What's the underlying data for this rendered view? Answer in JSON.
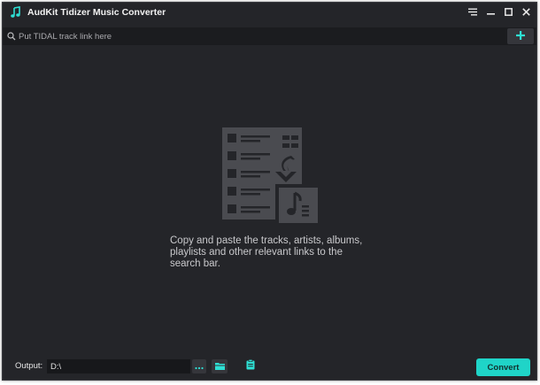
{
  "titlebar": {
    "title": "AudKit Tidizer Music Converter",
    "icons": [
      "music-note-logo",
      "menu-icon",
      "minimize-icon",
      "maximize-icon",
      "close-icon"
    ]
  },
  "search": {
    "placeholder": "Put TIDAL track link here",
    "value": "",
    "add_icon": "plus-icon"
  },
  "main": {
    "hint": "Copy and paste the tracks, artists, albums, playlists and other relevant links to the search bar.",
    "illustration_icon": "playlist-music-icon"
  },
  "footer": {
    "output_label": "Output:",
    "output_path": "D:\\",
    "more_icon": "ellipsis-icon",
    "folder_icon": "folder-icon",
    "history_icon": "history-list-icon",
    "convert_label": "Convert"
  },
  "colors": {
    "accent": "#1fd4c8",
    "background": "#242529",
    "searchbar": "#1b1c1f",
    "illustration": "#4a4b50"
  }
}
